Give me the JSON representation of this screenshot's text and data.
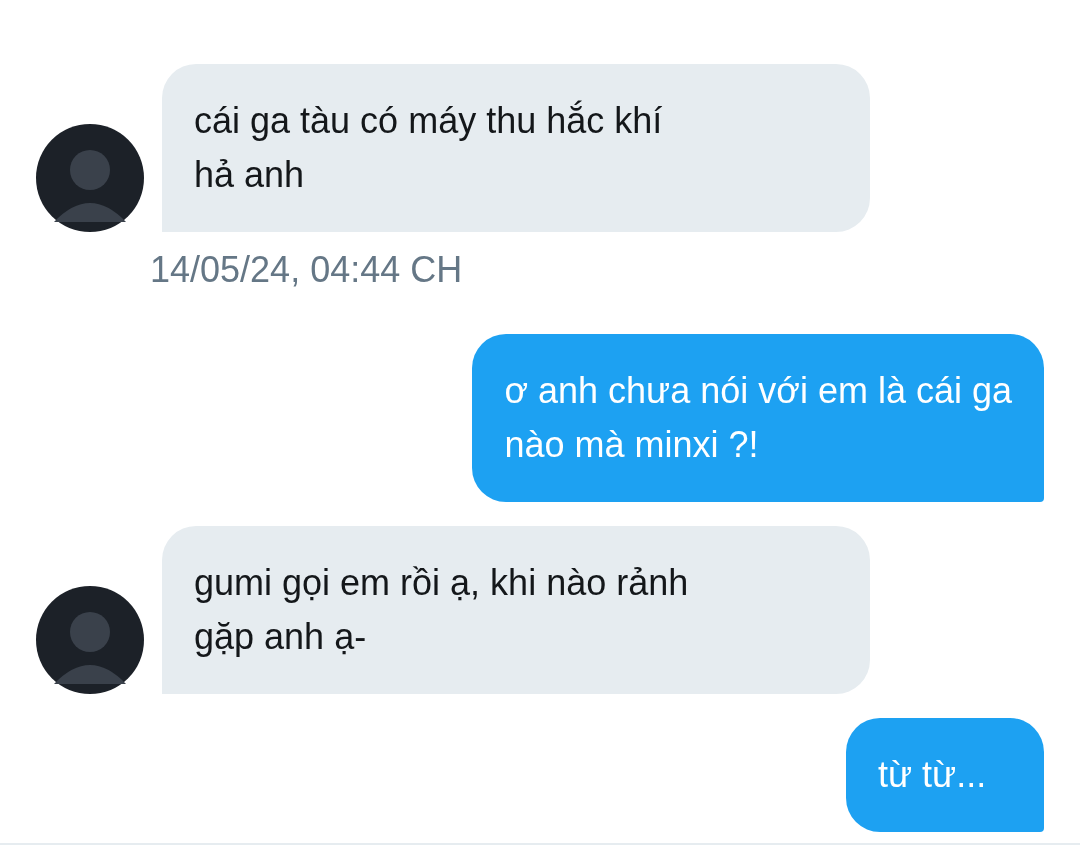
{
  "messages": [
    {
      "kind": "received",
      "lines": [
        "cái ga tàu có máy thu hắc khí",
        "hả anh"
      ]
    },
    {
      "kind": "timestamp",
      "text": "14/05/24, 04:44 CH"
    },
    {
      "kind": "sent",
      "lines": [
        "ơ anh chưa nói với em là cái ga",
        "nào mà minxi ?!"
      ]
    },
    {
      "kind": "received",
      "lines": [
        "gumi gọi em rồi ạ, khi nào rảnh",
        "gặp anh ạ-"
      ]
    },
    {
      "kind": "sent",
      "lines": [
        "từ từ..."
      ]
    }
  ]
}
